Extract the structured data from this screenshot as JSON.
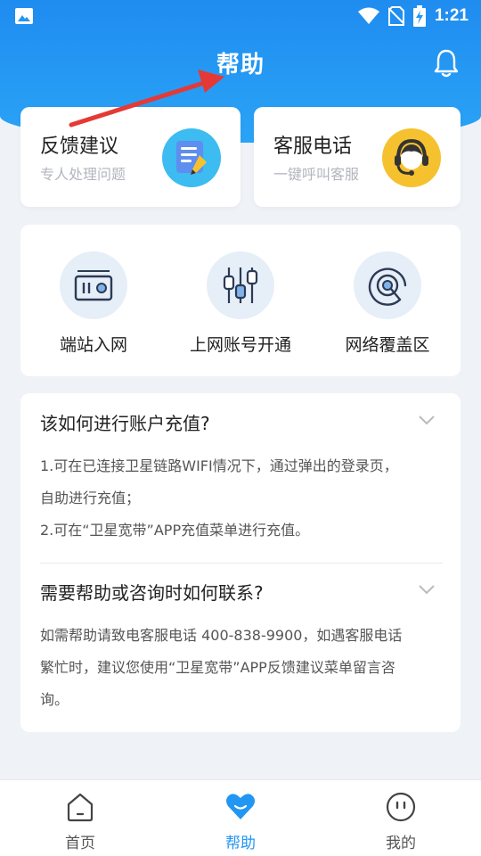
{
  "status_bar": {
    "time": "1:21"
  },
  "header": {
    "title": "帮助"
  },
  "cards": {
    "feedback": {
      "title": "反馈建议",
      "subtitle": "专人处理问题"
    },
    "service": {
      "title": "客服电话",
      "subtitle": "一键呼叫客服"
    }
  },
  "quick_links": [
    {
      "label": "端站入网",
      "icon": "radio-device-icon"
    },
    {
      "label": "上网账号开通",
      "icon": "sliders-icon"
    },
    {
      "label": "网络覆盖区",
      "icon": "coverage-target-icon"
    }
  ],
  "faq": [
    {
      "question": "该如何进行账户充值?",
      "answer_lines": [
        "1.可在已连接卫星链路WIFI情况下，通过弹出的登录页，",
        "自助进行充值；",
        "2.可在“卫星宽带”APP充值菜单进行充值。"
      ]
    },
    {
      "question": "需要帮助或咨询时如何联系?",
      "answer_lines": [
        "如需帮助请致电客服电话 400-838-9900，如遇客服电话",
        "繁忙时，建议您使用“卫星宽带”APP反馈建议菜单留言咨",
        "询。"
      ]
    }
  ],
  "bottom_nav": [
    {
      "label": "首页",
      "active": false
    },
    {
      "label": "帮助",
      "active": true
    },
    {
      "label": "我的",
      "active": false
    }
  ],
  "colors": {
    "primary": "#2196f3",
    "header_start": "#1f8cf0",
    "header_end": "#2aa4f6",
    "arrow": "#e53935"
  }
}
